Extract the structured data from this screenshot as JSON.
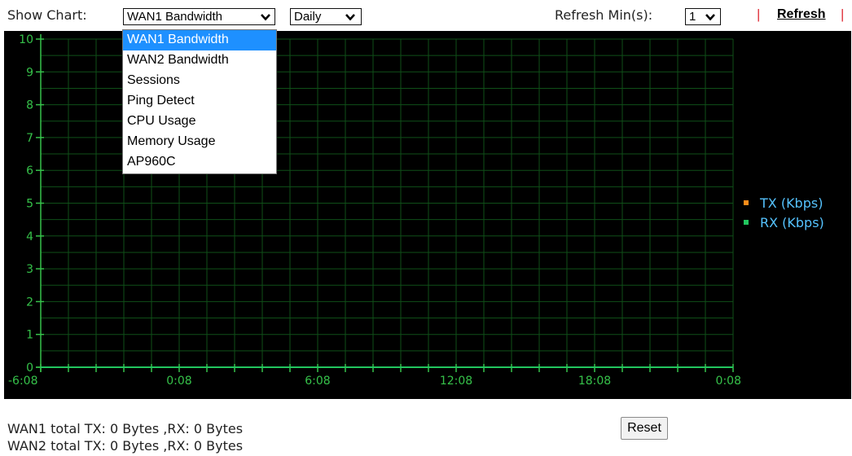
{
  "toolbar": {
    "show_chart_label": "Show Chart:",
    "chart_select_value": "WAN1 Bandwidth",
    "period_select_value": "Daily",
    "refresh_min_label": "Refresh Min(s):",
    "refresh_min_value": "1",
    "separator": "|",
    "refresh_label": "Refresh"
  },
  "dropdown": {
    "options": [
      "WAN1 Bandwidth",
      "WAN2 Bandwidth",
      "Sessions",
      "Ping Detect",
      "CPU Usage",
      "Memory Usage",
      "AP960C"
    ],
    "selected_index": 0
  },
  "chart_data": {
    "type": "line",
    "x_tick_labels": [
      "-6:08",
      "0:08",
      "6:08",
      "12:08",
      "18:08",
      "0:08"
    ],
    "y_ticks": [
      0,
      1,
      2,
      3,
      4,
      5,
      6,
      7,
      8,
      9,
      10
    ],
    "ylim": [
      0,
      10
    ],
    "grid": true,
    "legend_position": "right",
    "series": [
      {
        "name": "TX (Kbps)",
        "color": "#ff8c1a",
        "values": [
          0,
          0,
          0,
          0,
          0,
          0
        ]
      },
      {
        "name": "RX (Kbps)",
        "color": "#22c55e",
        "values": [
          0,
          0,
          0,
          0,
          0,
          0
        ]
      }
    ],
    "colors": {
      "background": "#000000",
      "grid": "#0f4f18",
      "axis": "#36c24a",
      "tick_text": "#36c24a"
    }
  },
  "stats": {
    "wan1": "WAN1 total TX: 0 Bytes ,RX: 0 Bytes",
    "wan2": "WAN2 total TX: 0 Bytes ,RX: 0 Bytes"
  },
  "reset_label": "Reset"
}
